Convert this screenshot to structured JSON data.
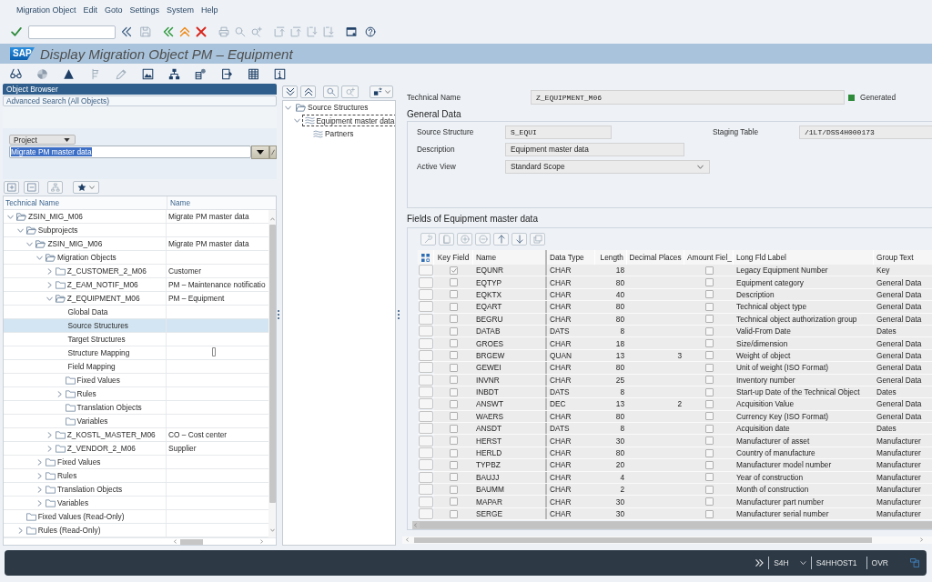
{
  "menu": [
    "Migration Object",
    "Edit",
    "Goto",
    "Settings",
    "System",
    "Help"
  ],
  "title": {
    "logo": "SAP",
    "text": "Display Migration Object PM – Equipment"
  },
  "object_browser": {
    "header": "Object Browser",
    "tab": "Advanced Search (All Objects)",
    "scope_dropdown": "Project",
    "search_field": {
      "value": "Migrate PM master data",
      "highlighted": true
    },
    "tree": {
      "columns": [
        "Technical Name",
        "Name"
      ],
      "items": [
        {
          "technical_name": "ZSIN_MIG_M06",
          "name": "Migrate PM master data",
          "kind": "folder-open",
          "expanded": true,
          "selected": false,
          "children": [
            {
              "technical_name": "Subprojects",
              "kind": "folder-open",
              "expanded": true,
              "selected": false,
              "children": [
                {
                  "technical_name": "ZSIN_MIG_M06",
                  "name": "Migrate PM master data",
                  "kind": "folder-open",
                  "expanded": true,
                  "selected": false,
                  "children": [
                    {
                      "technical_name": "Migration Objects",
                      "kind": "folder-open",
                      "expanded": true,
                      "selected": false,
                      "children": [
                        {
                          "technical_name": "Z_CUSTOMER_2_M06",
                          "name": "Customer",
                          "kind": "folder",
                          "expanded": false,
                          "selected": false
                        },
                        {
                          "technical_name": "Z_EAM_NOTIF_M06",
                          "name": "PM – Maintenance notificatio",
                          "kind": "folder",
                          "expanded": false,
                          "selected": false
                        },
                        {
                          "technical_name": "Z_EQUIPMENT_M06",
                          "name": "PM – Equipment",
                          "kind": "folder-open",
                          "expanded": true,
                          "selected": false,
                          "children": [
                            {
                              "technical_name": "Global Data",
                              "kind": "step",
                              "selected": false
                            },
                            {
                              "technical_name": "Source Structures",
                              "kind": "step",
                              "selected": true
                            },
                            {
                              "technical_name": "Target Structures",
                              "kind": "step",
                              "selected": false
                            },
                            {
                              "technical_name": "Structure Mapping",
                              "kind": "step",
                              "selected": false
                            },
                            {
                              "technical_name": "Field Mapping",
                              "kind": "step",
                              "selected": false
                            },
                            {
                              "technical_name": "Fixed Values",
                              "kind": "folder",
                              "selected": false
                            },
                            {
                              "technical_name": "Rules",
                              "kind": "folder",
                              "expanded": false,
                              "selected": false
                            },
                            {
                              "technical_name": "Translation Objects",
                              "kind": "folder",
                              "selected": false
                            },
                            {
                              "technical_name": "Variables",
                              "kind": "folder",
                              "selected": false
                            }
                          ]
                        },
                        {
                          "technical_name": "Z_KOSTL_MASTER_M06",
                          "name": "CO – Cost center",
                          "kind": "folder",
                          "expanded": false,
                          "selected": false
                        },
                        {
                          "technical_name": "Z_VENDOR_2_M06",
                          "name": "Supplier",
                          "kind": "folder",
                          "expanded": false,
                          "selected": false
                        }
                      ]
                    },
                    {
                      "technical_name": "Fixed Values",
                      "kind": "folder",
                      "expanded": false,
                      "selected": false
                    },
                    {
                      "technical_name": "Rules",
                      "kind": "folder",
                      "expanded": false,
                      "selected": false
                    },
                    {
                      "technical_name": "Translation Objects",
                      "kind": "folder",
                      "expanded": false,
                      "selected": false
                    },
                    {
                      "technical_name": "Variables",
                      "kind": "folder",
                      "expanded": false,
                      "selected": false
                    }
                  ]
                }
              ]
            },
            {
              "technical_name": "Fixed Values (Read-Only)",
              "kind": "folder",
              "selected": false
            },
            {
              "technical_name": "Rules (Read-Only)",
              "kind": "folder",
              "expanded": false,
              "selected": false
            }
          ]
        }
      ]
    }
  },
  "structure_tree": {
    "items": [
      {
        "label": "Source Structures",
        "kind": "folder-open",
        "expanded": true,
        "selected": false,
        "children": [
          {
            "label": "Equipment master data",
            "kind": "structure",
            "expanded": true,
            "selected": true,
            "children": [
              {
                "label": "Partners",
                "kind": "structure",
                "selected": false
              }
            ]
          }
        ]
      }
    ]
  },
  "details": {
    "technical_name": {
      "label": "Technical Name",
      "value": "Z_EQUIPMENT_M06"
    },
    "status": {
      "label": "Generated",
      "color": "#2e8b3a"
    },
    "general_data": {
      "title": "General Data",
      "source_structure": {
        "label": "Source Structure",
        "value": "S_EQUI"
      },
      "staging_table": {
        "label": "Staging Table",
        "value": "/1LT/DSS4H000173"
      },
      "description": {
        "label": "Description",
        "value": "Equipment master data"
      },
      "active_view": {
        "label": "Active View",
        "value": "Standard Scope"
      }
    }
  },
  "fields_table": {
    "title": "Fields of Equipment master data",
    "columns": [
      "Key Field",
      "Name",
      "Data Type",
      "Length",
      "Decimal Places",
      "Amount Fiel_",
      "Long Fld Label",
      "Group Text"
    ],
    "rows": [
      {
        "key_field": true,
        "name": "EQUNR",
        "data_type": "CHAR",
        "length": "18",
        "amount_field": false,
        "long_label": "Legacy Equipment Number",
        "group_text": "Key"
      },
      {
        "key_field": false,
        "name": "EQTYP",
        "data_type": "CHAR",
        "length": "80",
        "amount_field": false,
        "long_label": "Equipment category",
        "group_text": "General Data"
      },
      {
        "key_field": false,
        "name": "EQKTX",
        "data_type": "CHAR",
        "length": "40",
        "amount_field": false,
        "long_label": "Description",
        "group_text": "General Data"
      },
      {
        "key_field": false,
        "name": "EQART",
        "data_type": "CHAR",
        "length": "80",
        "amount_field": false,
        "long_label": "Technical object type",
        "group_text": "General Data"
      },
      {
        "key_field": false,
        "name": "BEGRU",
        "data_type": "CHAR",
        "length": "80",
        "amount_field": false,
        "long_label": "Technical object authorization group",
        "group_text": "General Data"
      },
      {
        "key_field": false,
        "name": "DATAB",
        "data_type": "DATS",
        "length": "8",
        "amount_field": false,
        "long_label": "Valid-From Date",
        "group_text": "Dates"
      },
      {
        "key_field": false,
        "name": "GROES",
        "data_type": "CHAR",
        "length": "18",
        "amount_field": false,
        "long_label": "Size/dimension",
        "group_text": "General Data"
      },
      {
        "key_field": false,
        "name": "BRGEW",
        "data_type": "QUAN",
        "length": "13",
        "decimal_places": "3",
        "amount_field": false,
        "long_label": "Weight of object",
        "group_text": "General Data"
      },
      {
        "key_field": false,
        "name": "GEWEI",
        "data_type": "CHAR",
        "length": "80",
        "amount_field": false,
        "long_label": "Unit of weight (ISO Format)",
        "group_text": "General Data"
      },
      {
        "key_field": false,
        "name": "INVNR",
        "data_type": "CHAR",
        "length": "25",
        "amount_field": false,
        "long_label": "Inventory number",
        "group_text": "General Data"
      },
      {
        "key_field": false,
        "name": "INBDT",
        "data_type": "DATS",
        "length": "8",
        "amount_field": false,
        "long_label": "Start-up Date of the Technical Object",
        "group_text": "Dates"
      },
      {
        "key_field": false,
        "name": "ANSWT",
        "data_type": "DEC",
        "length": "13",
        "decimal_places": "2",
        "amount_field": false,
        "long_label": "Acquisition Value",
        "group_text": "General Data"
      },
      {
        "key_field": false,
        "name": "WAERS",
        "data_type": "CHAR",
        "length": "80",
        "amount_field": false,
        "long_label": "Currency Key (ISO Format)",
        "group_text": "General Data"
      },
      {
        "key_field": false,
        "name": "ANSDT",
        "data_type": "DATS",
        "length": "8",
        "amount_field": false,
        "long_label": "Acquisition date",
        "group_text": "Dates"
      },
      {
        "key_field": false,
        "name": "HERST",
        "data_type": "CHAR",
        "length": "30",
        "amount_field": false,
        "long_label": "Manufacturer of asset",
        "group_text": "Manufacturer"
      },
      {
        "key_field": false,
        "name": "HERLD",
        "data_type": "CHAR",
        "length": "80",
        "amount_field": false,
        "long_label": "Country of manufacture",
        "group_text": "Manufacturer"
      },
      {
        "key_field": false,
        "name": "TYPBZ",
        "data_type": "CHAR",
        "length": "20",
        "amount_field": false,
        "long_label": "Manufacturer model number",
        "group_text": "Manufacturer"
      },
      {
        "key_field": false,
        "name": "BAUJJ",
        "data_type": "CHAR",
        "length": "4",
        "amount_field": false,
        "long_label": "Year of construction",
        "group_text": "Manufacturer"
      },
      {
        "key_field": false,
        "name": "BAUMM",
        "data_type": "CHAR",
        "length": "2",
        "amount_field": false,
        "long_label": "Month of construction",
        "group_text": "Manufacturer"
      },
      {
        "key_field": false,
        "name": "MAPAR",
        "data_type": "CHAR",
        "length": "30",
        "amount_field": false,
        "long_label": "Manufacturer part number",
        "group_text": "Manufacturer"
      },
      {
        "key_field": false,
        "name": "SERGE",
        "data_type": "CHAR",
        "length": "30",
        "amount_field": false,
        "long_label": "Manufacturer serial number",
        "group_text": "Manufacturer"
      }
    ]
  },
  "status_bar": {
    "system": "S4H",
    "host": "S4HHOST1",
    "mode": "OVR"
  }
}
